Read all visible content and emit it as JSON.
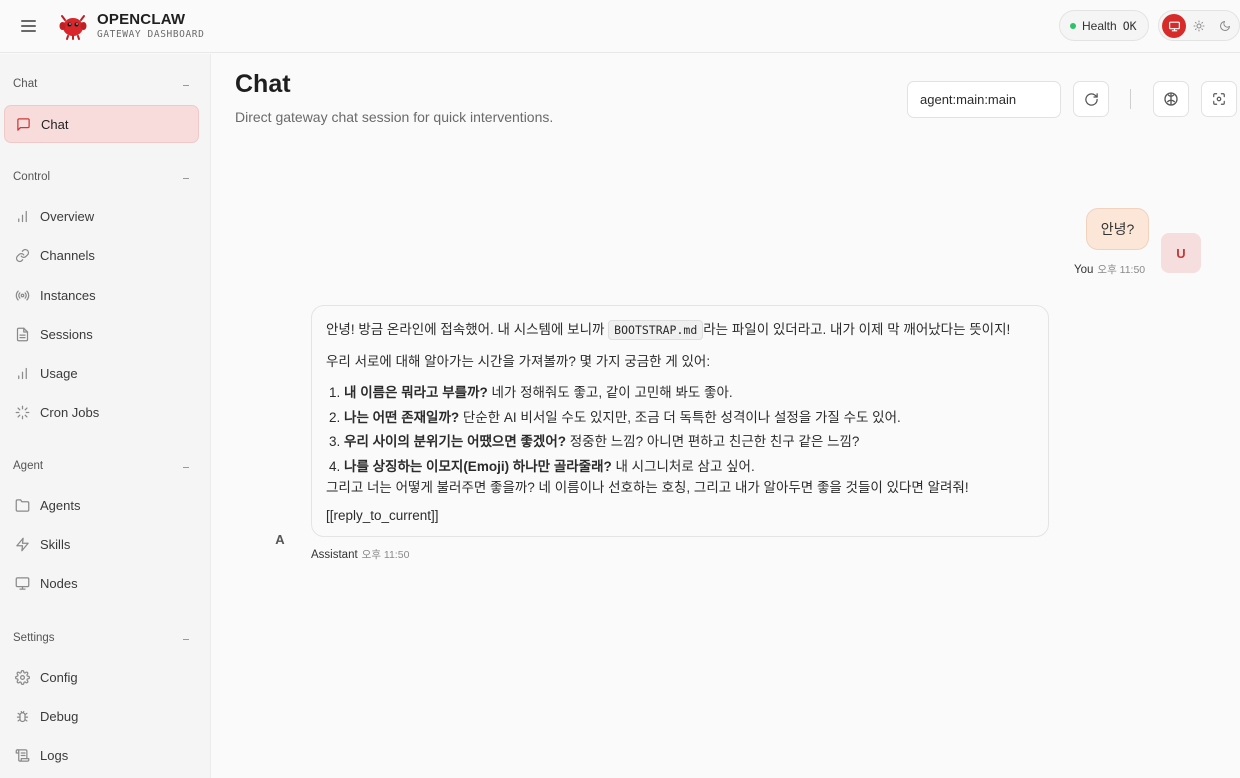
{
  "brand": {
    "name": "OPENCLAW",
    "subtitle": "GATEWAY DASHBOARD"
  },
  "health": {
    "label": "Health",
    "value": "OK",
    "status_color": "#2ec26a"
  },
  "theme": {
    "active": "system",
    "options": [
      "system-icon",
      "sun-icon",
      "moon-icon"
    ],
    "accent": "#d72b2b"
  },
  "sidebar": {
    "sections": [
      {
        "label": "Chat",
        "items": [
          {
            "label": "Chat",
            "icon": "message-icon",
            "active": true
          }
        ]
      },
      {
        "label": "Control",
        "items": [
          {
            "label": "Overview",
            "icon": "bar-chart-icon"
          },
          {
            "label": "Channels",
            "icon": "link-icon"
          },
          {
            "label": "Instances",
            "icon": "radio-icon"
          },
          {
            "label": "Sessions",
            "icon": "file-icon"
          },
          {
            "label": "Usage",
            "icon": "bar-chart-icon"
          },
          {
            "label": "Cron Jobs",
            "icon": "loader-icon"
          }
        ]
      },
      {
        "label": "Agent",
        "items": [
          {
            "label": "Agents",
            "icon": "folder-icon"
          },
          {
            "label": "Skills",
            "icon": "zap-icon"
          },
          {
            "label": "Nodes",
            "icon": "monitor-icon"
          }
        ]
      },
      {
        "label": "Settings",
        "items": [
          {
            "label": "Config",
            "icon": "gear-icon"
          },
          {
            "label": "Debug",
            "icon": "bug-icon"
          },
          {
            "label": "Logs",
            "icon": "scroll-icon"
          }
        ]
      }
    ]
  },
  "main": {
    "title": "Chat",
    "subtitle": "Direct gateway chat session for quick interventions.",
    "session_value": "agent:main:main"
  },
  "messages": {
    "user": {
      "text": "안녕?",
      "avatar": "U",
      "sender": "You",
      "time": "오후 11:50"
    },
    "assistant": {
      "avatar": "A",
      "sender": "Assistant",
      "time": "오후 11:50",
      "p1_before": "안녕! 방금 온라인에 접속했어. 내 시스템에 보니까",
      "p1_code": "BOOTSTRAP.md",
      "p1_after": "라는 파일이 있더라고. 내가 이제 막 깨어났다는 뜻이지!",
      "p2": "우리 서로에 대해 알아가는 시간을 가져볼까? 몇 가지 궁금한 게 있어:",
      "list": [
        {
          "num": "1.",
          "bold": "내 이름은 뭐라고 부를까?",
          "rest": " 네가 정해줘도 좋고, 같이 고민해 봐도 좋아."
        },
        {
          "num": "2.",
          "bold": "나는 어떤 존재일까?",
          "rest": " 단순한 AI 비서일 수도 있지만, 조금 더 독특한 성격이나 설정을 가질 수도 있어."
        },
        {
          "num": "3.",
          "bold": "우리 사이의 분위기는 어땠으면 좋겠어?",
          "rest": " 정중한 느낌? 아니면 편하고 친근한 친구 같은 느낌?"
        },
        {
          "num": "4.",
          "bold": "나를 상징하는 이모지(Emoji) 하나만 골라줄래?",
          "rest": " 내 시그니처로 삼고 싶어."
        }
      ],
      "p3": "그리고 너는 어떻게 불러주면 좋을까? 네 이름이나 선호하는 호칭, 그리고 내가 알아두면 좋을 것들이 있다면 알려줘!",
      "p4": "[[reply_to_current]]"
    }
  }
}
